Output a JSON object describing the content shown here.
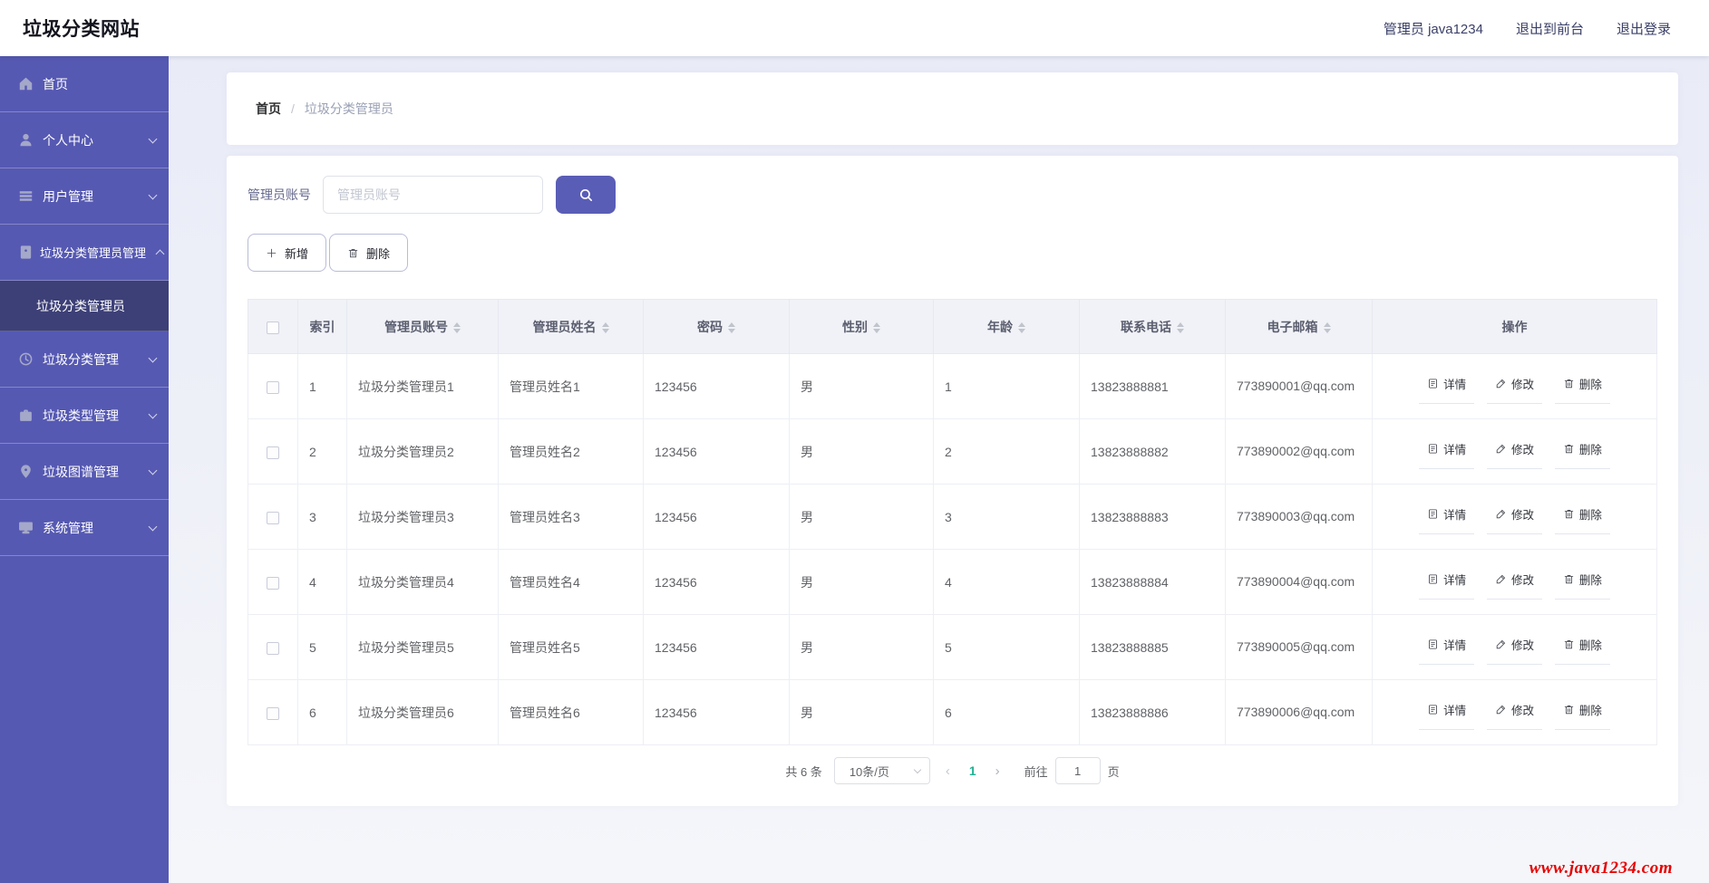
{
  "header": {
    "brand": "垃圾分类网站",
    "user": "管理员 java1234",
    "exit_front": "退出到前台",
    "logout": "退出登录"
  },
  "sidebar": {
    "items": [
      {
        "label": "首页",
        "icon": "home-icon",
        "chevron": "none"
      },
      {
        "label": "个人中心",
        "icon": "user-icon",
        "chevron": "down"
      },
      {
        "label": "用户管理",
        "icon": "list-icon",
        "chevron": "down"
      },
      {
        "label": "垃圾分类管理员管理",
        "icon": "badge-icon",
        "chevron": "up",
        "children": [
          {
            "label": "垃圾分类管理员",
            "active": true
          }
        ]
      },
      {
        "label": "垃圾分类管理",
        "icon": "clock-icon",
        "chevron": "down"
      },
      {
        "label": "垃圾类型管理",
        "icon": "briefcase-icon",
        "chevron": "down"
      },
      {
        "label": "垃圾图谱管理",
        "icon": "pin-icon",
        "chevron": "down"
      },
      {
        "label": "系统管理",
        "icon": "monitor-icon",
        "chevron": "down"
      }
    ]
  },
  "breadcrumb": {
    "home": "首页",
    "separator": "/",
    "current": "垃圾分类管理员"
  },
  "search": {
    "label": "管理员账号",
    "placeholder": "管理员账号",
    "value": ""
  },
  "toolbar": {
    "add_label": "新增",
    "delete_label": "删除"
  },
  "table": {
    "columns": [
      "索引",
      "管理员账号",
      "管理员姓名",
      "密码",
      "性别",
      "年龄",
      "联系电话",
      "电子邮箱",
      "操作"
    ],
    "actions": {
      "detail": "详情",
      "edit": "修改",
      "delete": "删除"
    },
    "rows": [
      {
        "index": "1",
        "account": "垃圾分类管理员1",
        "name": "管理员姓名1",
        "password": "123456",
        "gender": "男",
        "age": "1",
        "phone": "13823888881",
        "email": "773890001@qq.com"
      },
      {
        "index": "2",
        "account": "垃圾分类管理员2",
        "name": "管理员姓名2",
        "password": "123456",
        "gender": "男",
        "age": "2",
        "phone": "13823888882",
        "email": "773890002@qq.com"
      },
      {
        "index": "3",
        "account": "垃圾分类管理员3",
        "name": "管理员姓名3",
        "password": "123456",
        "gender": "男",
        "age": "3",
        "phone": "13823888883",
        "email": "773890003@qq.com"
      },
      {
        "index": "4",
        "account": "垃圾分类管理员4",
        "name": "管理员姓名4",
        "password": "123456",
        "gender": "男",
        "age": "4",
        "phone": "13823888884",
        "email": "773890004@qq.com"
      },
      {
        "index": "5",
        "account": "垃圾分类管理员5",
        "name": "管理员姓名5",
        "password": "123456",
        "gender": "男",
        "age": "5",
        "phone": "13823888885",
        "email": "773890005@qq.com"
      },
      {
        "index": "6",
        "account": "垃圾分类管理员6",
        "name": "管理员姓名6",
        "password": "123456",
        "gender": "男",
        "age": "6",
        "phone": "13823888886",
        "email": "773890006@qq.com"
      }
    ]
  },
  "pagination": {
    "total_text": "共 6 条",
    "page_size": "10条/页",
    "prev": "‹",
    "current_page": "1",
    "next": "›",
    "goto_label": "前往",
    "goto_value": "1",
    "page_suffix": "页"
  },
  "footer": {
    "watermark": "www.java1234.com"
  },
  "colors": {
    "sidebar": "#5659b2",
    "sidebar_active": "#3d4077",
    "accent_purple": "#5a5db6",
    "pagination_active": "#21b294",
    "watermark_red": "#e60000",
    "table_header_bg": "#f1f2f7",
    "content_bg": "#eceef8"
  }
}
